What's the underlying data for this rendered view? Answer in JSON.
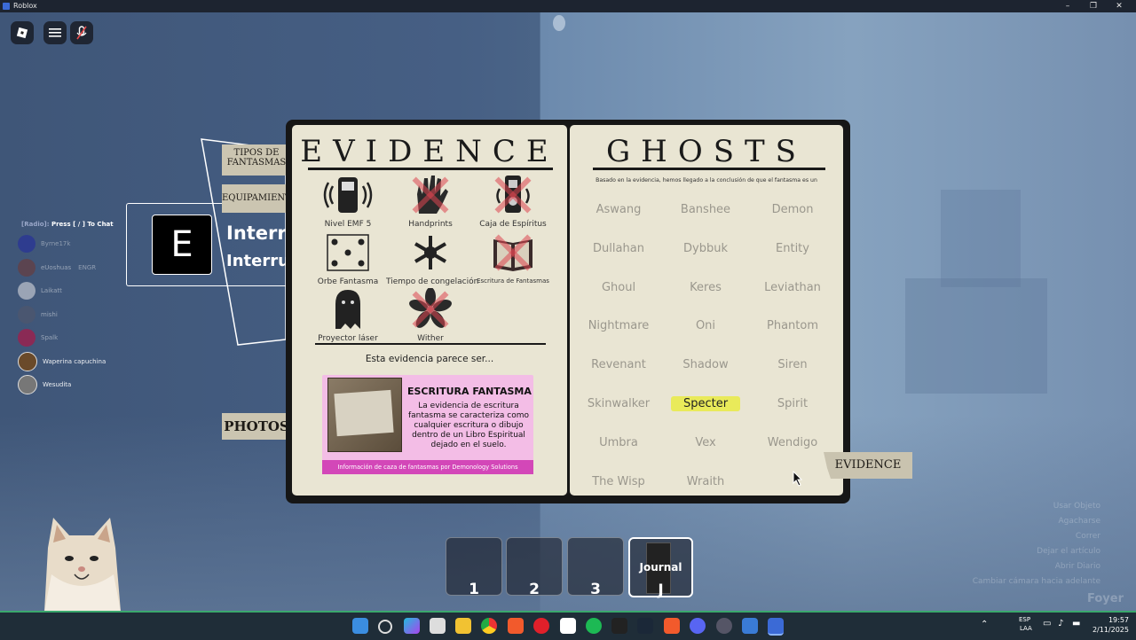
{
  "window": {
    "title": "Roblox"
  },
  "chat": {
    "header_channel": "[Radio]:",
    "header_text": "Press [ / ] To Chat",
    "players": [
      {
        "name": "Byrne17k",
        "extra": ""
      },
      {
        "name": "eUoshuas",
        "extra": "ENGR"
      },
      {
        "name": "Laikatt",
        "extra": ""
      },
      {
        "name": "mishi",
        "extra": ""
      },
      {
        "name": "Spalk",
        "extra": ""
      },
      {
        "name": "Waperina capuchina",
        "extra": ""
      },
      {
        "name": "Wesudita",
        "extra": ""
      }
    ]
  },
  "side_tabs": {
    "tipos": "TIPOS DE FANTASMAS",
    "equipamiento": "EQUIPAMIENTO",
    "photos": "PHOTOS",
    "evidence": "EVIDENCE"
  },
  "interact": {
    "key": "E",
    "line1": "Interr",
    "line2": "Interru"
  },
  "evidence_page": {
    "title": "EVIDENCE",
    "items": [
      {
        "label": "Nivel EMF 5",
        "crossed": false
      },
      {
        "label": "Handprints",
        "crossed": true
      },
      {
        "label": "Caja de Espíritus",
        "crossed": true
      },
      {
        "label": "Orbe Fantasma",
        "crossed": false
      },
      {
        "label": "Tiempo de congelación",
        "crossed": false
      },
      {
        "label": "Escritura de Fantasmas",
        "crossed": true
      },
      {
        "label": "Proyector láser",
        "crossed": false
      },
      {
        "label": "Wither",
        "crossed": true
      }
    ],
    "seems": "Esta evidencia parece ser...",
    "card": {
      "title": "ESCRITURA FANTASMA",
      "body": "La evidencia de escritura fantasma se caracteriza como cualquier escritura o dibujo dentro de un Libro Espiritual dejado en el suelo.",
      "footer": "Información de caza de fantasmas por Demonology Solutions"
    }
  },
  "ghosts_page": {
    "title": "GHOSTS",
    "conclusion": "Basado en la evidencia, hemos llegado a la conclusión de que el fantasma es un",
    "ghosts": [
      "Aswang",
      "Banshee",
      "Demon",
      "Dullahan",
      "Dybbuk",
      "Entity",
      "Ghoul",
      "Keres",
      "Leviathan",
      "Nightmare",
      "Oni",
      "Phantom",
      "Revenant",
      "Shadow",
      "Siren",
      "Skinwalker",
      "Specter",
      "Spirit",
      "Umbra",
      "Vex",
      "Wendigo",
      "The Wisp",
      "Wraith"
    ],
    "highlighted": "Specter"
  },
  "hotbar": {
    "slots": [
      {
        "num": "1",
        "label": ""
      },
      {
        "num": "2",
        "label": ""
      },
      {
        "num": "3",
        "label": ""
      },
      {
        "num": "J",
        "label": "Journal"
      }
    ]
  },
  "faded_menu": [
    "Usar Objeto",
    "Agacharse",
    "Correr",
    "Dejar el artículo",
    "Abrir Diario",
    "Cambiar cámara hacia adelante",
    "Foyer"
  ],
  "taskbar": {
    "lang1": "ESP",
    "lang2": "LAA",
    "time": "19:57",
    "date": "2/11/2025"
  },
  "colors": {
    "page": "#e9e5d3",
    "highlight": "#e9ea5a",
    "card": "#f3bde6",
    "card_footer": "#d347b8",
    "cross": "#dc4650"
  }
}
